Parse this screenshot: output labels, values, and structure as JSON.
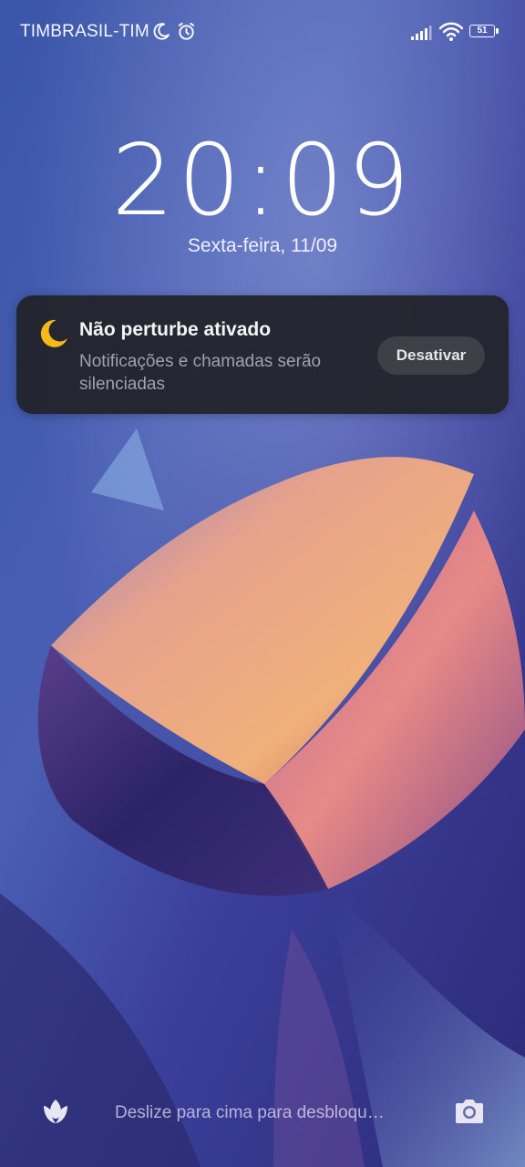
{
  "status_bar": {
    "carrier": "TIMBRASIL-TIM",
    "battery_level": "51",
    "icons": [
      "moon-icon",
      "alarm-icon",
      "signal-icon",
      "wifi-icon",
      "battery-icon"
    ]
  },
  "lockscreen": {
    "time": "20:09",
    "date": "Sexta-feira, 11/09"
  },
  "notification": {
    "icon": "moon-icon",
    "title": "Não perturbe ativado",
    "body": "Notificações e chamadas serão silenciadas",
    "action_label": "Desativar"
  },
  "bottom_bar": {
    "left_icon": "tulip-icon",
    "hint": "Deslize para cima para desbloqu…",
    "right_icon": "camera-icon"
  },
  "colors": {
    "notification_bg": "#22242c",
    "moon_accent": "#f7b917",
    "button_bg": "#3e4048",
    "wallpaper_base": "#3d4f9c"
  }
}
